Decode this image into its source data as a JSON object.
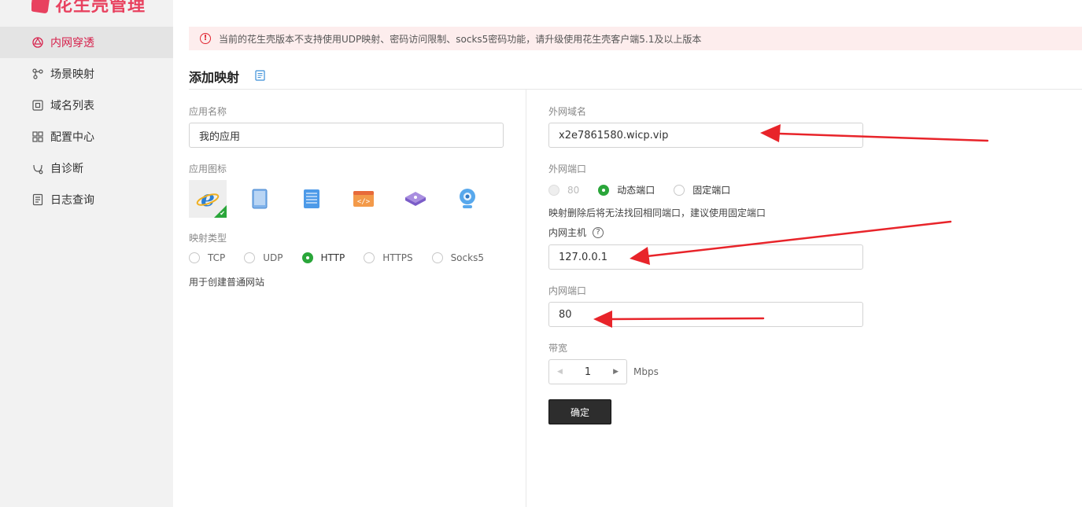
{
  "brand": {
    "name": "花生壳管理",
    "color": "#e8415f"
  },
  "sidebar": {
    "items": [
      {
        "label": "内网穿透",
        "icon": "network-penetration-icon",
        "active": true
      },
      {
        "label": "场景映射",
        "icon": "scene-map-icon"
      },
      {
        "label": "域名列表",
        "icon": "domain-list-icon"
      },
      {
        "label": "配置中心",
        "icon": "config-center-icon"
      },
      {
        "label": "自诊断",
        "icon": "self-diagnose-icon"
      },
      {
        "label": "日志查询",
        "icon": "log-query-icon"
      }
    ]
  },
  "alert": {
    "text": "当前的花生壳版本不支持使用UDP映射、密码访问限制、socks5密码功能，请升级使用花生壳客户端5.1及以上版本"
  },
  "page": {
    "title": "添加映射"
  },
  "form": {
    "app_name_label": "应用名称",
    "app_name_value": "我的应用",
    "app_icon_label": "应用图标",
    "app_icons": [
      "ie-browser-icon",
      "tablet-icon",
      "server-icon",
      "code-window-icon",
      "router-icon",
      "webcam-icon"
    ],
    "mapping_type_label": "映射类型",
    "mapping_types": [
      "TCP",
      "UDP",
      "HTTP",
      "HTTPS",
      "Socks5"
    ],
    "mapping_type_selected": "HTTP",
    "mapping_type_hint": "用于创建普通网站",
    "external_domain_label": "外网域名",
    "external_domain_value": "x2e7861580.wicp.vip",
    "external_port_label": "外网端口",
    "external_port_options": [
      "80",
      "动态端口",
      "固定端口"
    ],
    "external_port_selected": "动态端口",
    "external_port_hint": "映射删除后将无法找回相同端口，建议使用固定端口",
    "internal_host_label": "内网主机",
    "internal_host_value": "127.0.0.1",
    "internal_port_label": "内网端口",
    "internal_port_value": "80",
    "bandwidth_label": "带宽",
    "bandwidth_value": "1",
    "bandwidth_unit": "Mbps",
    "confirm_label": "确定"
  },
  "colors": {
    "accent_green": "#2aa63a",
    "alert_red": "#e0242f",
    "arrow_red": "#e8242a"
  }
}
